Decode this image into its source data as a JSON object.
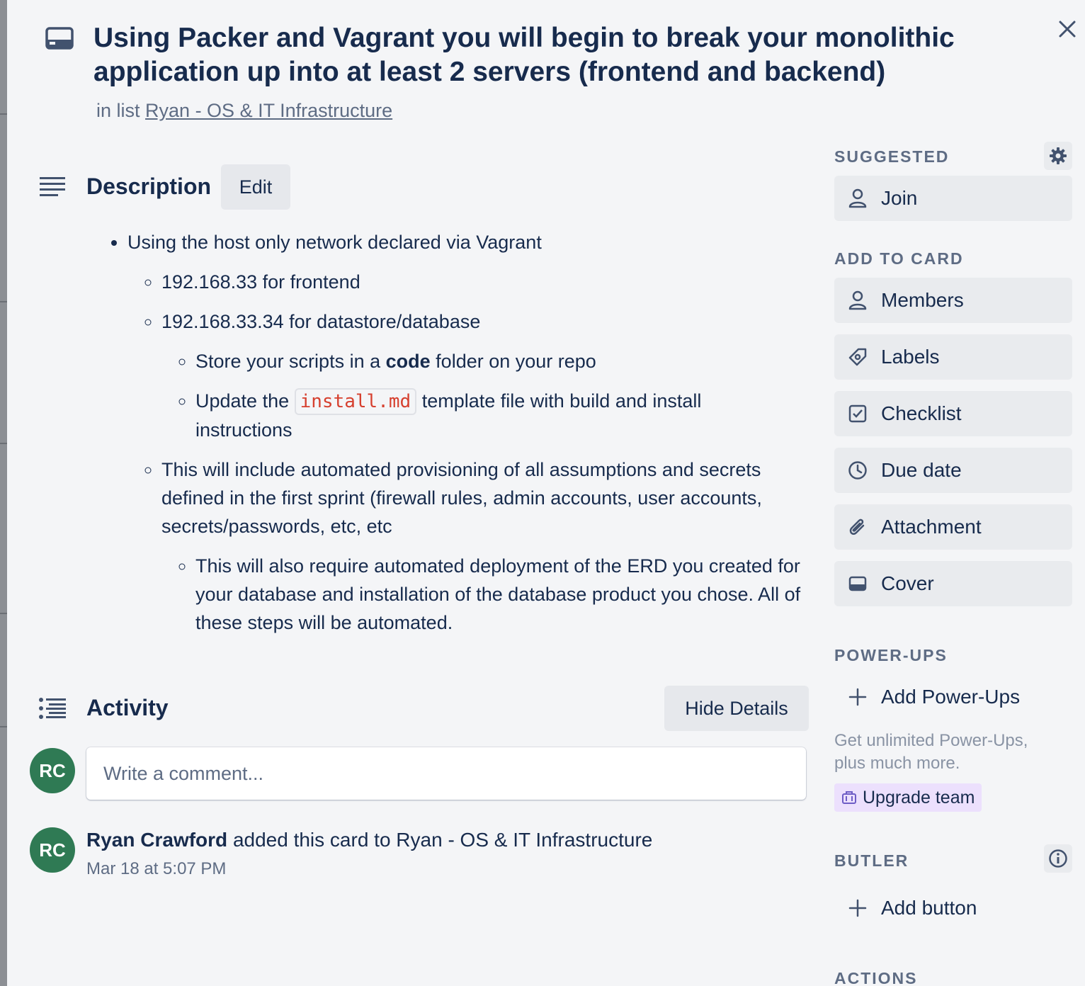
{
  "card": {
    "title": "Using Packer and Vagrant you will begin to break your monolithic application up into at least 2 servers (frontend and backend)",
    "in_list_prefix": "in list",
    "list_name": "Ryan - OS & IT Infrastructure"
  },
  "description": {
    "heading": "Description",
    "edit_label": "Edit",
    "item1": "Using the host only network declared via Vagrant",
    "sub1": "192.168.33 for frontend",
    "sub2": "192.168.33.34 for datastore/database",
    "sub2a_pre": "Store your scripts in a",
    "sub2a_bold": "code",
    "sub2a_post": "folder on your repo",
    "sub2b_pre": "Update the",
    "sub2b_code": "install.md",
    "sub2b_post": "template file with build and install instructions",
    "sub3": "This will include automated provisioning of all assumptions and secrets defined in the first sprint (firewall rules, admin accounts, user accounts, secrets/passwords, etc, etc",
    "sub3a": "This will also require automated deployment of the ERD you created for your database and installation of the database product you chose. All of these steps will be automated."
  },
  "activity": {
    "heading": "Activity",
    "hide_details_label": "Hide Details",
    "avatar_initials": "RC",
    "comment_placeholder": "Write a comment...",
    "entry_user": "Ryan Crawford",
    "entry_text": "added this card to Ryan - OS & IT Infrastructure",
    "entry_time": "Mar 18 at 5:07 PM"
  },
  "sidebar": {
    "suggested_label": "SUGGESTED",
    "join_label": "Join",
    "add_to_card_label": "ADD TO CARD",
    "members_label": "Members",
    "labels_label": "Labels",
    "checklist_label": "Checklist",
    "due_date_label": "Due date",
    "attachment_label": "Attachment",
    "cover_label": "Cover",
    "powerups_label": "POWER-UPS",
    "add_powerups_label": "Add Power-Ups",
    "promo_text": "Get unlimited Power-Ups, plus much more.",
    "upgrade_label": "Upgrade team",
    "butler_label": "BUTLER",
    "add_button_label": "Add button",
    "actions_label": "ACTIONS"
  },
  "colors": {
    "avatar": "#2f7a54",
    "code_text": "#d6402f",
    "upgrade_bg": "#ece0fd"
  }
}
